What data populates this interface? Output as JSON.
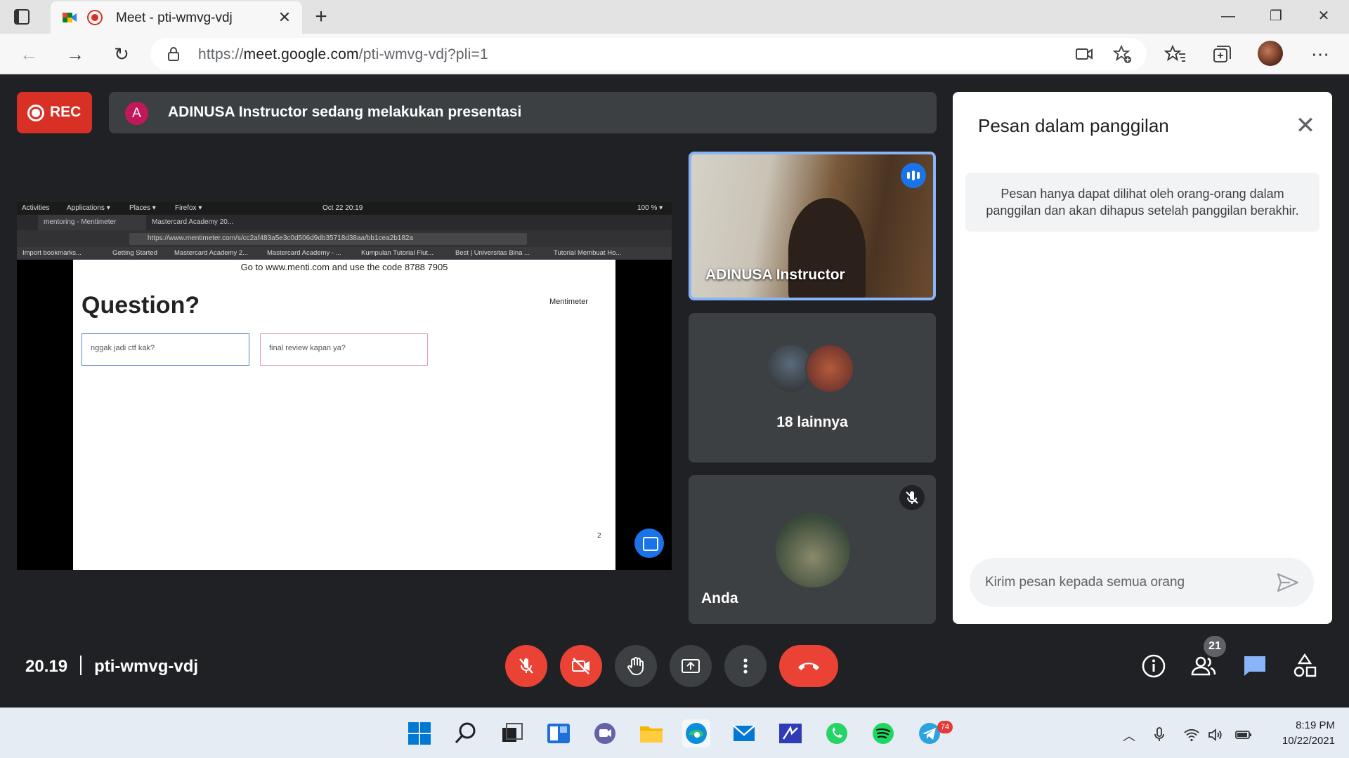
{
  "browser": {
    "tab_title": "Meet - pti-wmvg-vdj",
    "url_prefix": "https://",
    "url_host": "meet.google.com",
    "url_path": "/pti-wmvg-vdj?pli=1"
  },
  "meet": {
    "rec_label": "REC",
    "presenter_initial": "A",
    "presenting_text": "ADINUSA Instructor sedang melakukan presentasi",
    "time": "20.19",
    "meeting_code": "pti-wmvg-vdj",
    "people_count": "21",
    "accent_color": "#8ab4f8",
    "end_call_color": "#ea4335"
  },
  "shared_screen": {
    "gnome": {
      "activities": "Activities",
      "applications": "Applications ▾",
      "places": "Places ▾",
      "firefox": "Firefox ▾",
      "clock": "Oct 22  20:19",
      "battery": "100 % ▾"
    },
    "tabs": [
      "mentoring - Mentimeter",
      "Mastercard Academy 20..."
    ],
    "url": "https://www.mentimeter.com/s/cc2af483a5e3c0d506d9db35718d38aa/bb1cea2b182a",
    "bookmarks": [
      "Import bookmarks...",
      "Getting Started",
      "Mastercard Academy 2...",
      "Mastercard Academy - ...",
      "Kumpulan Tutorial Flut...",
      "Best | Universitas Bina ...",
      "Tutorial Membuat Ho..."
    ],
    "code_line": "Go to www.menti.com and use the code 8788 7905",
    "question": "Question?",
    "brand": "Mentimeter",
    "answers": [
      "nggak jadi ctf kak?",
      "final review kapan ya?"
    ],
    "participants_shown": "2"
  },
  "tiles": {
    "instructor_name": "ADINUSA Instructor",
    "others_label": "18 lainnya",
    "me_name": "Anda"
  },
  "chat": {
    "title": "Pesan dalam panggilan",
    "notice": "Pesan hanya dapat dilihat oleh orang-orang dalam panggilan dan akan dihapus setelah panggilan berakhir.",
    "input_placeholder": "Kirim pesan kepada semua orang"
  },
  "taskbar": {
    "time": "8:19 PM",
    "date": "10/22/2021",
    "telegram_badge": "74"
  }
}
